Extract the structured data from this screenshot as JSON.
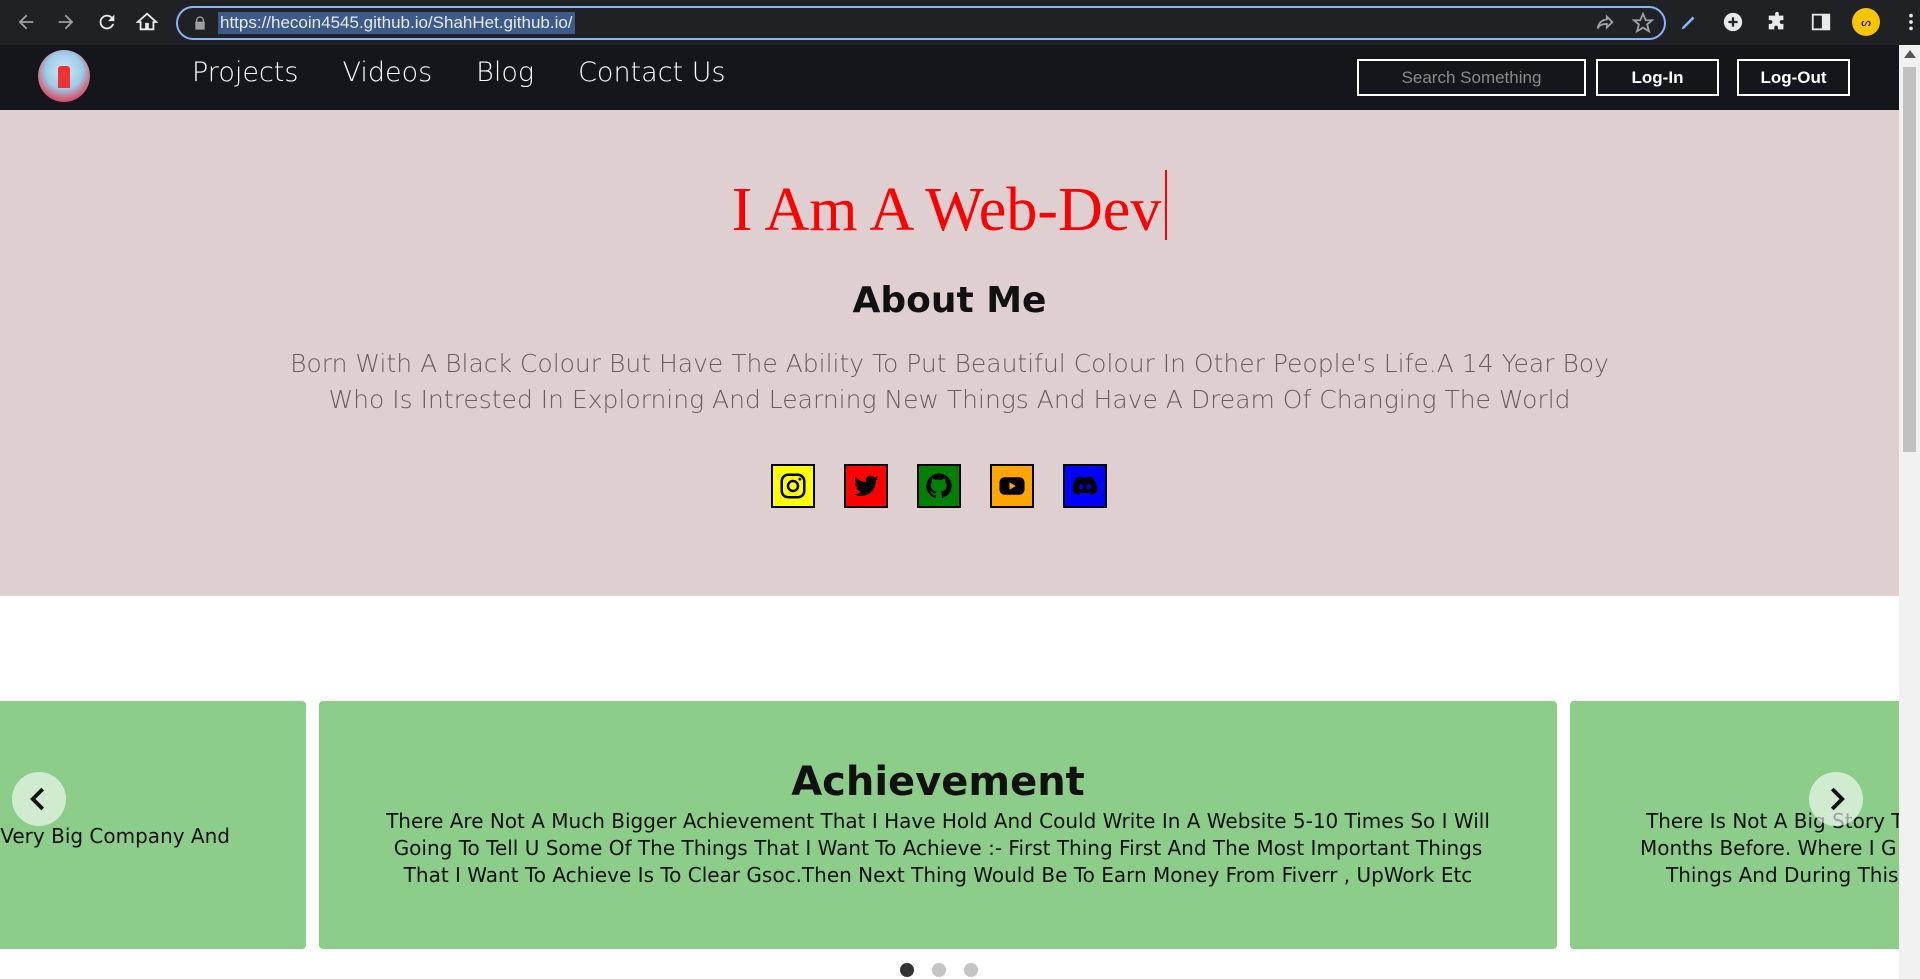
{
  "browser": {
    "url": "https://hecoin4545.github.io/ShahHet.github.io/",
    "profile_initials": "ᔕ"
  },
  "navbar": {
    "links": [
      "Projects",
      "Videos",
      "Blog",
      "Contact Us"
    ],
    "search_placeholder": "Search Something",
    "login_label": "Log-In",
    "logout_label": "Log-Out"
  },
  "hero": {
    "headline": "I Am A Web-Dev",
    "about_title": "About Me",
    "about_text": "Born With A Black Colour But Have The Ability To Put Beautiful Colour In Other People's Life.A 14 Year Boy Who Is Intrested In Explorning And Learning New Things And Have A Dream Of Changing The World",
    "socials": [
      {
        "icon": "instagram-icon",
        "color": "#ffff00"
      },
      {
        "icon": "twitter-icon",
        "color": "#ff0000"
      },
      {
        "icon": "github-icon",
        "color": "#008000"
      },
      {
        "icon": "youtube-icon",
        "color": "#ffa500"
      },
      {
        "icon": "discord-icon",
        "color": "#0000ff"
      }
    ]
  },
  "carousel": {
    "left_slide_text": "f A Very Big Company And",
    "center_title": "Achievement",
    "center_text": "There Are Not A Much Bigger Achievement That I Have Hold And Could Write In A Website 5-10 Times So I Will Going To Tell U Some Of The Things That I Want To Achieve :- First Thing First And The Most Important Things That I Want To Achieve Is To Clear Gsoc.Then Next Thing Would Be To Earn Money From Fiverr , UpWork Etc",
    "right_slide_lines": [
      "There Is Not A Big Story T",
      "Months Before. Where I G",
      "Things And During This"
    ],
    "active_dot": 0,
    "dot_count": 3
  }
}
